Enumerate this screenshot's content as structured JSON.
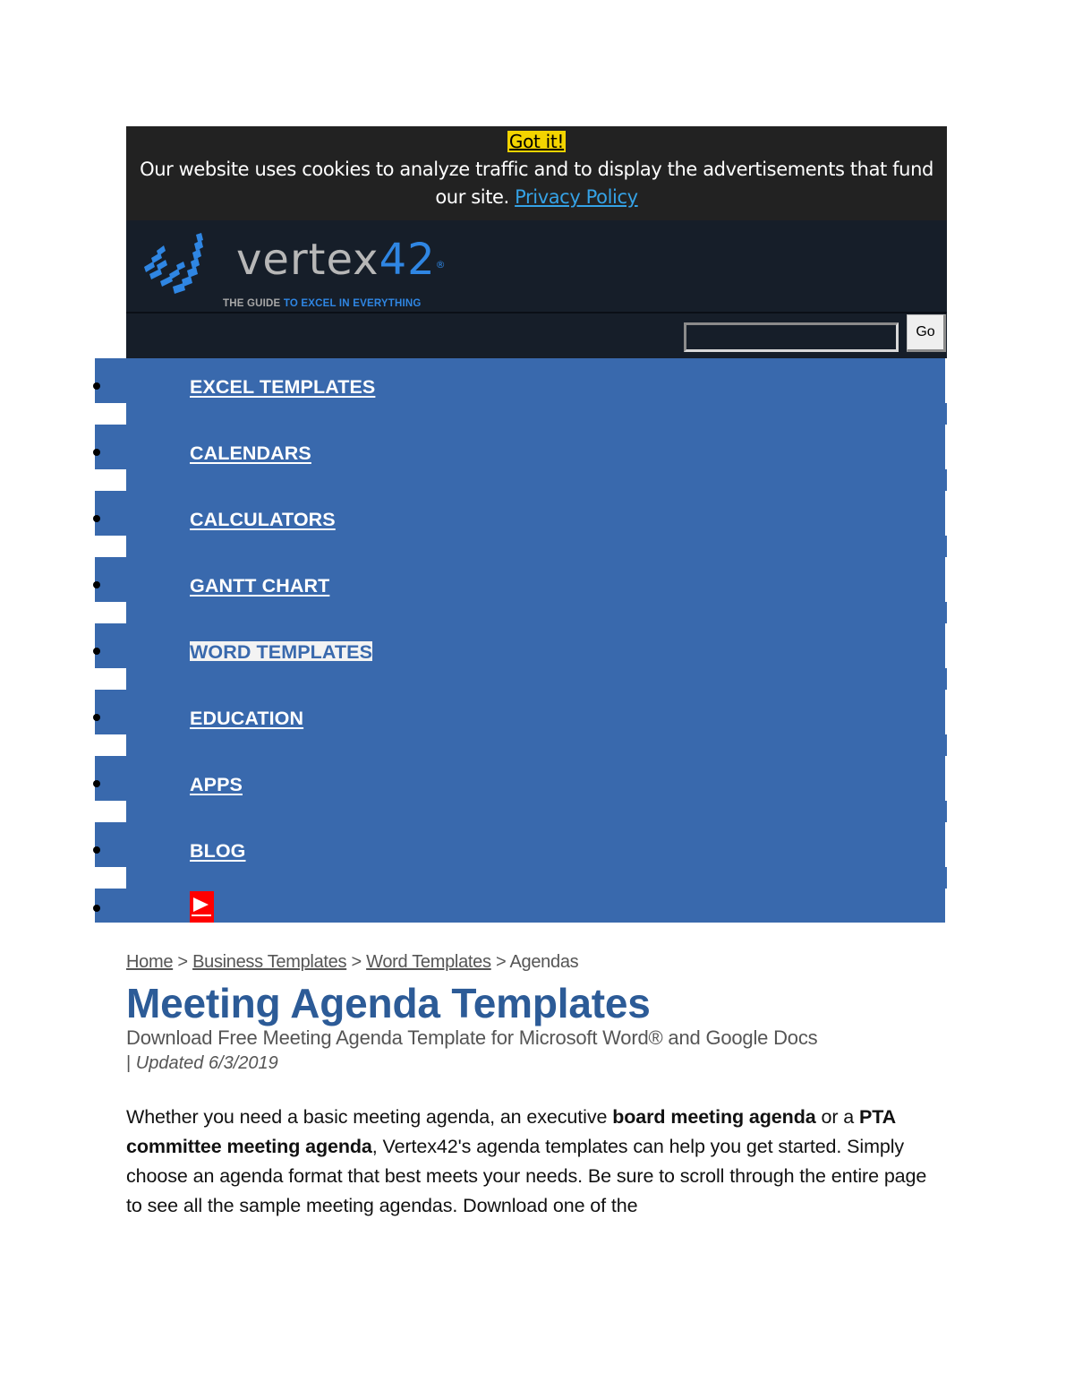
{
  "cookie_banner": {
    "button_label": "Got it!",
    "message": "Our website uses cookies to analyze traffic and to display the advertisements that fund our site.",
    "link_label": "Privacy Policy",
    "button_color": "#f3d400",
    "link_color": "#35a2e6"
  },
  "header": {
    "logo": {
      "word": "vertex",
      "number": "42",
      "registered": "®",
      "tagline_prefix": "THE GUIDE",
      "tagline_suffix": "TO EXCEL IN EVERYTHING"
    },
    "search": {
      "value": "",
      "placeholder": "",
      "button_label": "Go"
    }
  },
  "nav": {
    "background_color": "#3969ad",
    "items": [
      {
        "label": "EXCEL TEMPLATES",
        "active": false
      },
      {
        "label": "CALENDARS",
        "active": false
      },
      {
        "label": "CALCULATORS",
        "active": false
      },
      {
        "label": "GANTT CHART",
        "active": false
      },
      {
        "label": "WORD TEMPLATES",
        "active": true
      },
      {
        "label": "EDUCATION",
        "active": false
      },
      {
        "label": "APPS",
        "active": false
      },
      {
        "label": "BLOG",
        "active": false
      }
    ],
    "youtube_icon": "play-icon"
  },
  "breadcrumb": {
    "items": [
      {
        "label": "Home",
        "link": true
      },
      {
        "label": "Business Templates",
        "link": true
      },
      {
        "label": "Word Templates",
        "link": true
      },
      {
        "label": "Agendas",
        "link": false
      }
    ],
    "separator": ">"
  },
  "page": {
    "title": "Meeting Agenda Templates",
    "subtitle": "Download Free Meeting Agenda Template for Microsoft Word® and Google Docs",
    "updated_bar": "|",
    "updated": "Updated 6/3/2019",
    "title_color": "#2c5b97"
  },
  "intro": {
    "part1": "Whether you need a basic meeting agenda, an executive ",
    "bold1": "board meeting agenda",
    "part2": " or a ",
    "bold2": "PTA committee meeting agenda",
    "part3": ", Vertex42's agenda templates can help you get started. Simply choose an agenda format that best meets your needs. Be sure to scroll through the entire page to see all the sample meeting agendas. Download one of the"
  }
}
